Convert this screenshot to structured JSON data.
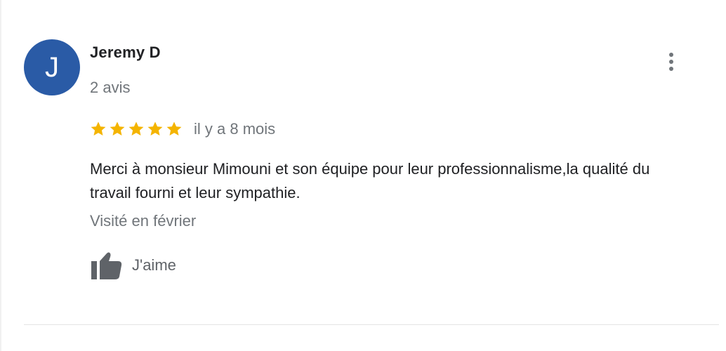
{
  "review": {
    "avatar_initial": "J",
    "avatar_color": "#2a5ba6",
    "author_name": "Jeremy D",
    "review_count": "2 avis",
    "rating": 5,
    "rating_max": 5,
    "star_color": "#f4b400",
    "time_ago": "il y a 8 mois",
    "text": "Merci à monsieur Mimouni et son équipe pour leur professionnalisme,la qualité du travail fourni et leur sympathie.",
    "visited": "Visité en février",
    "like_label": "J'aime",
    "more_icon": "more-vert-icon",
    "like_icon": "thumb-up-icon"
  }
}
